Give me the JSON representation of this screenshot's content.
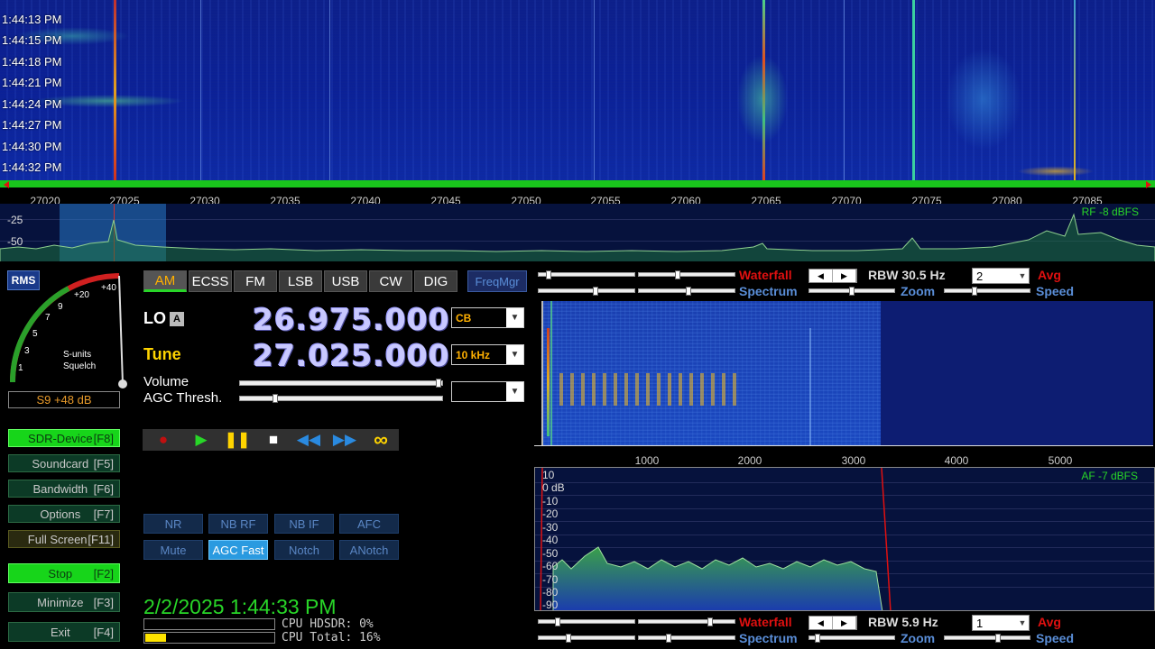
{
  "rf_waterfall": {
    "timestamps": [
      "1:44:13 PM",
      "1:44:15 PM",
      "1:44:18 PM",
      "1:44:21 PM",
      "1:44:24 PM",
      "1:44:27 PM",
      "1:44:30 PM",
      "1:44:32 PM"
    ]
  },
  "rf_scale": {
    "ticks": [
      "27020",
      "27025",
      "27030",
      "27035",
      "27040",
      "27045",
      "27050",
      "27055",
      "27060",
      "27065",
      "27070",
      "27075",
      "27080",
      "27085"
    ]
  },
  "rf_spectrum": {
    "db_labels": [
      "-25",
      "-50"
    ],
    "level": "RF  -8 dBFS"
  },
  "smeter": {
    "rms_label": "RMS",
    "scale": [
      "1",
      "3",
      "5",
      "7",
      "9",
      "+20",
      "+40"
    ],
    "caption_1": "S-units",
    "caption_2": "Squelch",
    "reading": "S9 +48 dB"
  },
  "function_buttons": [
    {
      "label": "SDR-Device",
      "key": "[F8]"
    },
    {
      "label": "Soundcard",
      "key": "[F5]"
    },
    {
      "label": "Bandwidth",
      "key": "[F6]"
    },
    {
      "label": "Options",
      "key": "[F7]"
    },
    {
      "label": "Full Screen",
      "key": "[F11]"
    },
    {
      "label": "Stop",
      "key": "[F2]"
    },
    {
      "label": "Minimize",
      "key": "[F3]"
    },
    {
      "label": "Exit",
      "key": "[F4]"
    }
  ],
  "modes": [
    "AM",
    "ECSS",
    "FM",
    "LSB",
    "USB",
    "CW",
    "DIG"
  ],
  "freqmgr": "FreqMgr",
  "lo": {
    "label": "LO",
    "badge": "A",
    "freq": "26.975.000",
    "band": "CB"
  },
  "tune": {
    "label": "Tune",
    "freq": "27.025.000",
    "step": "10 kHz"
  },
  "sliders": {
    "volume": "Volume",
    "agc": "AGC Thresh."
  },
  "dsp_buttons": [
    "NR",
    "NB RF",
    "NB IF",
    "AFC",
    "Mute",
    "AGC Fast",
    "Notch",
    "ANotch"
  ],
  "datetime": "2/2/2025 1:44:33 PM",
  "cpu": {
    "hdsdr": "CPU HDSDR: 0%",
    "total": "CPU Total: 16%",
    "total_percent": 16
  },
  "rf_controls": {
    "waterfall": "Waterfall",
    "spectrum": "Spectrum",
    "rbw": "RBW 30.5 Hz",
    "zoom": "Zoom",
    "avg_value": "2",
    "avg": "Avg",
    "speed": "Speed"
  },
  "af_scale": {
    "ticks": [
      "1000",
      "2000",
      "3000",
      "4000",
      "5000"
    ]
  },
  "af_spectrum": {
    "db_labels": [
      "10",
      "0 dB",
      "-10",
      "-20",
      "-30",
      "-40",
      "-50",
      "-60",
      "-70",
      "-80",
      "-90"
    ],
    "level": "AF  -7 dBFS"
  },
  "af_controls": {
    "waterfall": "Waterfall",
    "spectrum": "Spectrum",
    "rbw": "RBW  5.9 Hz",
    "zoom": "Zoom",
    "avg_value": "1",
    "avg": "Avg",
    "speed": "Speed"
  },
  "colors": {
    "accent_green": "#28d628",
    "label_red": "#e01010",
    "label_blue": "#5a8ed8",
    "tune_yellow": "#ffd400"
  }
}
